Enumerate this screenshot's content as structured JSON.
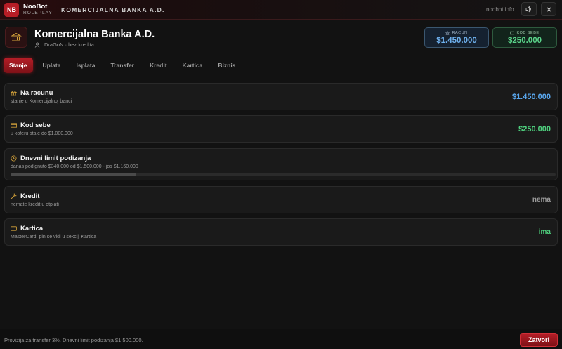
{
  "topbar": {
    "logo": "NB",
    "brand": "NooBot",
    "brand_sub": "ROLEPLAY",
    "title": "KOMERCIJALNA BANKA A.D.",
    "site": "noobot.info"
  },
  "header": {
    "title": "Komercijalna Banka A.D.",
    "user": "DraGoN · bez kredita"
  },
  "stats": {
    "racun": {
      "label": "RACUN",
      "value": "$1.450.000"
    },
    "kod_sebe": {
      "label": "KOD SEBE",
      "value": "$250.000"
    }
  },
  "tabs": [
    {
      "label": "Stanje"
    },
    {
      "label": "Uplata"
    },
    {
      "label": "Isplata"
    },
    {
      "label": "Transfer"
    },
    {
      "label": "Kredit"
    },
    {
      "label": "Kartica"
    },
    {
      "label": "Biznis"
    }
  ],
  "cards": {
    "racun": {
      "title": "Na racunu",
      "sub": "stanje u Komercijalnoj banci",
      "value": "$1.450.000",
      "color": "#5aa8f0"
    },
    "kod_sebe": {
      "title": "Kod sebe",
      "sub": "u koferu staje do $1.000.000",
      "value": "$250.000",
      "color": "#4fd27f"
    },
    "limit": {
      "title": "Dnevni limit podizanja",
      "sub": "danas podignuto $340.000 od $1.500.000 - jos $1.160.000",
      "progress": 0.23
    },
    "kredit": {
      "title": "Kredit",
      "sub": "nemate kredit u otplati",
      "value": "nema",
      "color": "#9a9a9a"
    },
    "kartica": {
      "title": "Kartica",
      "sub": "MasterCard, pin se vidi u sekciji Kartica",
      "value": "ima",
      "color": "#4fd27f"
    }
  },
  "footer": {
    "text": "Provizija za transfer 3%. Dnevni limit podizanja $1.500.000.",
    "close_label": "Zatvori"
  },
  "icons": {
    "bank": "bank-icon",
    "user": "user-icon",
    "sound": "speaker-icon",
    "close": "close-icon",
    "wallet": "wallet-icon",
    "clock": "clock-icon",
    "hammer": "gavel-icon",
    "card": "card-icon"
  },
  "colors": {
    "accent": "#b81d26",
    "blue": "#5aa8f0",
    "green": "#4fd27f",
    "gold": "#d4a23a"
  }
}
